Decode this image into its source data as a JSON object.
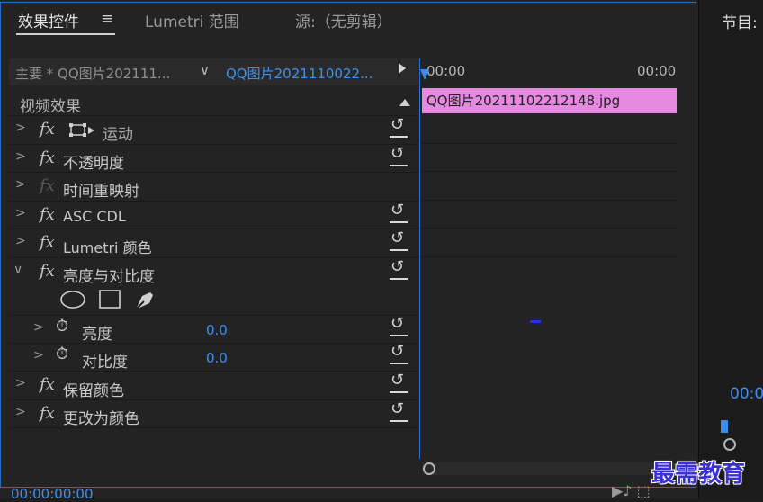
{
  "tabs": {
    "effects": "效果控件",
    "lumetri": "Lumetri 范围",
    "source": "源:（无剪辑）",
    "menu_icon": "hamburger-menu-icon"
  },
  "sources": {
    "master": "主要 * QQ图片202111...",
    "selected": "QQ图片2021110022..."
  },
  "timeline": {
    "tc_start": "00:00",
    "tc_end": "00:00",
    "clip_name": "QQ图片20211102212148.jpg",
    "clip_color": "#e58ae0"
  },
  "video_effects": {
    "header": "视频效果",
    "rows": [
      {
        "expander": ">",
        "fx": "fx",
        "label": "运动"
      },
      {
        "expander": ">",
        "fx": "fx",
        "label": "不透明度"
      },
      {
        "expander": ">",
        "fx": "fx",
        "label": "时间重映射"
      },
      {
        "expander": ">",
        "fx": "fx",
        "label": "ASC CDL"
      },
      {
        "expander": ">",
        "fx": "fx",
        "label": "Lumetri 颜色"
      },
      {
        "expander": "∨",
        "fx": "fx",
        "label": "亮度与对比度"
      },
      {
        "expander": ">",
        "label": "亮度",
        "value": "0.0"
      },
      {
        "expander": ">",
        "label": "对比度",
        "value": "0.0"
      },
      {
        "expander": ">",
        "fx": "fx",
        "label": "保留颜色"
      },
      {
        "expander": ">",
        "fx": "fx",
        "label": "更改为颜色"
      }
    ]
  },
  "status": {
    "timecode": "00:00:00:00"
  },
  "program": {
    "title": "节目:",
    "timecode": "00:0"
  },
  "watermark": "最需教育",
  "accent_color": "#3f8ff0"
}
